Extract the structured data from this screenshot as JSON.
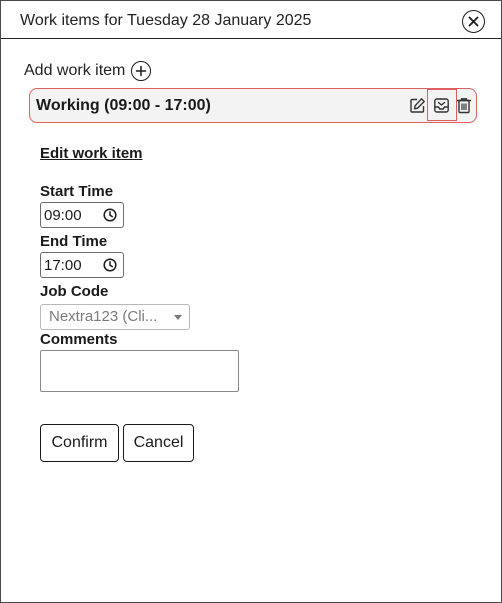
{
  "dialog": {
    "title": "Work items for Tuesday 28 January 2025",
    "close_icon": "close-circle-icon"
  },
  "add_work_item": {
    "label": "Add work item",
    "icon": "plus-circle-icon"
  },
  "work_item": {
    "label": "Working (09:00 - 17:00)",
    "actions": [
      "edit-icon",
      "submit-inbox-icon",
      "trash-icon"
    ],
    "border_color": "#e0605f"
  },
  "edit_form": {
    "heading": "Edit work item",
    "start_time": {
      "label": "Start Time",
      "value": "09:00"
    },
    "end_time": {
      "label": "End Time",
      "value": "17:00"
    },
    "job_code": {
      "label": "Job Code",
      "selected": "Nextra123 (Cli..."
    },
    "comments": {
      "label": "Comments",
      "value": ""
    },
    "confirm_label": "Confirm",
    "cancel_label": "Cancel"
  }
}
